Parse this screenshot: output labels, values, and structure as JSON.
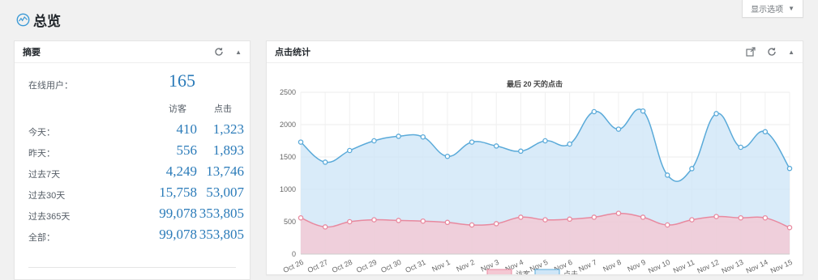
{
  "page": {
    "title": "总览",
    "screen_options_label": "显示选项"
  },
  "summary": {
    "title": "摘要",
    "online_label": "在线用户：",
    "online_value": "165",
    "col_visitors": "访客",
    "col_clicks": "点击",
    "rows": [
      {
        "label": "今天：",
        "visitors": "410",
        "clicks": "1,323"
      },
      {
        "label": "昨天：",
        "visitors": "556",
        "clicks": "1,893"
      },
      {
        "label": "过去7天",
        "visitors": "4,249",
        "clicks": "13,746"
      },
      {
        "label": "过去30天",
        "visitors": "15,758",
        "clicks": "53,007"
      },
      {
        "label": "过去365天",
        "visitors": "99,078",
        "clicks": "353,805"
      },
      {
        "label": "全部：",
        "visitors": "99,078",
        "clicks": "353,805"
      }
    ]
  },
  "clicks_panel": {
    "title": "点击统计"
  },
  "icons": {
    "logo": "stats-logo-icon",
    "refresh": "refresh-icon",
    "collapse": "caret-up-icon",
    "external": "external-link-icon",
    "dropdown": "caret-down-icon"
  },
  "colors": {
    "visitors_stroke": "#e8899f",
    "visitors_fill": "#f4c8d3",
    "clicks_stroke": "#5aaad9",
    "clicks_fill": "#cfe6f7",
    "value_text": "#2b7bb9"
  },
  "chart_data": {
    "type": "area",
    "title": "最后 20 天的点击",
    "categories": [
      "Oct 26",
      "Oct 27",
      "Oct 28",
      "Oct 29",
      "Oct 30",
      "Oct 31",
      "Nov 1",
      "Nov 2",
      "Nov 3",
      "Nov 4",
      "Nov 5",
      "Nov 6",
      "Nov 7",
      "Nov 8",
      "Nov 9",
      "Nov 10",
      "Nov 11",
      "Nov 12",
      "Nov 13",
      "Nov 14",
      "Nov 15"
    ],
    "yticks": [
      "0",
      "500",
      "1000",
      "1500",
      "2000",
      "2500"
    ],
    "ylim": [
      0,
      2500
    ],
    "grid": true,
    "legend_position": "bottom",
    "series": [
      {
        "name": "访客",
        "values": [
          560,
          420,
          500,
          530,
          520,
          510,
          490,
          450,
          470,
          570,
          530,
          540,
          570,
          630,
          570,
          450,
          530,
          580,
          560,
          560,
          410
        ]
      },
      {
        "name": "点击",
        "values": [
          1730,
          1420,
          1600,
          1750,
          1820,
          1810,
          1510,
          1730,
          1670,
          1590,
          1750,
          1700,
          2200,
          1930,
          2210,
          1220,
          1320,
          2170,
          1650,
          1890,
          1323
        ]
      }
    ]
  }
}
